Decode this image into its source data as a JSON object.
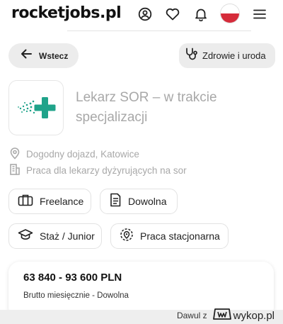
{
  "header": {
    "logo": "rocketjobs.pl",
    "icons": [
      "user-circle-icon",
      "heart-icon",
      "bell-icon",
      "poland-flag",
      "menu-icon"
    ]
  },
  "actions": {
    "back_label": "Wstecz",
    "category_label": "Zdrowie i uroda"
  },
  "job": {
    "title": "Lekarz SOR – w trakcie specjalizacji",
    "location": "Dogodny dojazd, Katowice",
    "company": "Praca dla lekarzy dyżyrujących na sor"
  },
  "chips": [
    {
      "label": "Freelance",
      "icon": "briefcase-icon"
    },
    {
      "label": "Dowolna",
      "icon": "document-icon"
    },
    {
      "label": "Staż / Junior",
      "icon": "graduation-cap-icon"
    },
    {
      "label": "Praca stacjonarna",
      "icon": "location-target-icon"
    }
  ],
  "salary": {
    "amount": "63 840 - 93 600 PLN",
    "subtitle": "Brutto miesięcznie - Dowolna"
  },
  "watermark": {
    "user": "Dawul z",
    "site": "wykop.pl"
  },
  "colors": {
    "accent_green": "#1fa38a",
    "flag_red": "#d52b3a",
    "muted_text": "#a8a8a8"
  }
}
